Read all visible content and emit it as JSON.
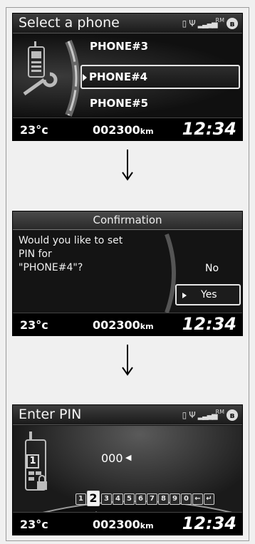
{
  "screens": [
    {
      "title": "Select a phone",
      "status": {
        "rm_label": "RM",
        "bt_symbol": "ʙ"
      },
      "list": [
        "PHONE#3",
        "PHONE#4",
        "PHONE#5"
      ],
      "selected_index": 1,
      "footer": {
        "temp": "23°c",
        "odo": "002300",
        "odo_unit": "km",
        "clock": "12:34"
      }
    },
    {
      "title": "Confirmation",
      "message_lines": [
        "Would you like to set",
        "PIN for",
        "\"PHONE#4\"?"
      ],
      "options": [
        "No",
        "Yes"
      ],
      "selected_option": "Yes",
      "footer": {
        "temp": "23°c",
        "odo": "002300",
        "odo_unit": "km",
        "clock": "12:34"
      }
    },
    {
      "title": "Enter PIN",
      "status": {
        "rm_label": "RM",
        "bt_symbol": "ʙ"
      },
      "phone_badge": "1",
      "pin_value": "000",
      "digits": [
        "1",
        "2",
        "3",
        "4",
        "5",
        "6",
        "7",
        "8",
        "9",
        "0",
        "←",
        "↵"
      ],
      "active_digit": "2",
      "footer": {
        "temp": "23°c",
        "odo": "002300",
        "odo_unit": "km",
        "clock": "12:34"
      }
    }
  ],
  "colors": {
    "screen_bg": "#141414",
    "text": "#ffffff",
    "highlight_border": "#e6e6e6"
  }
}
